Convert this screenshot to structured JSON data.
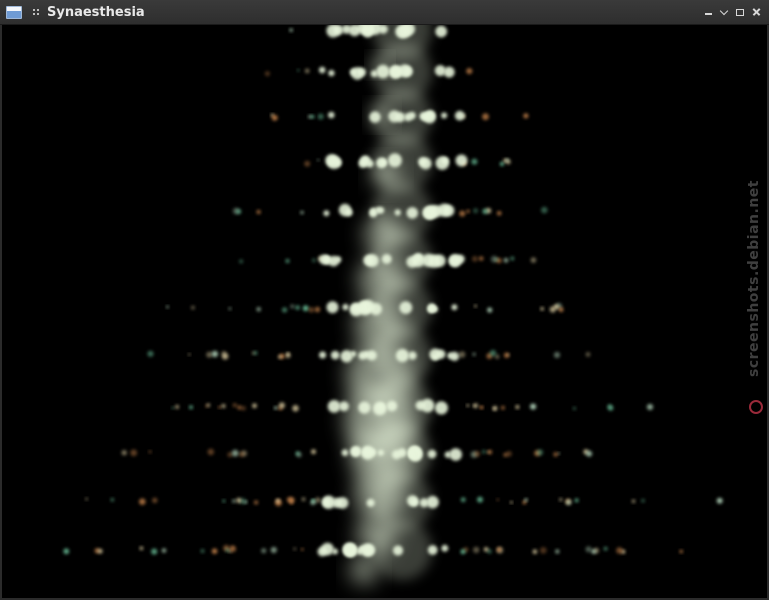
{
  "window": {
    "title": "Synaesthesia",
    "icon": "app-window-icon",
    "controls": {
      "minimize": "minimize-icon",
      "shade": "chevron-down-icon",
      "maximize": "maximize-icon",
      "close": "close-icon"
    }
  },
  "watermark": {
    "text": "screenshots.debian.net",
    "logo": "debian-swirl-icon",
    "color": "#9a2a3a"
  },
  "visualization": {
    "background": "#000000",
    "glow_color": "#e8f5dc",
    "accent_colors": [
      "#bfe3c8",
      "#6fc9a0",
      "#f0e0b0",
      "#d08a50"
    ]
  }
}
